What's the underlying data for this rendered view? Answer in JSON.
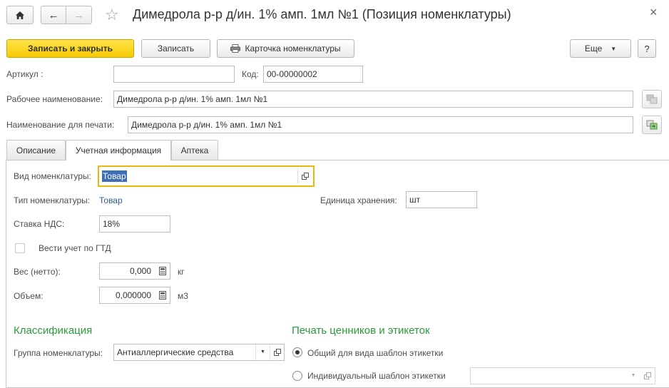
{
  "window": {
    "title": "Димедрола р-р д/ин. 1% амп. 1мл №1 (Позиция номенклатуры)",
    "close_symbol": "×"
  },
  "nav": {
    "home_icon": "home-icon",
    "back_symbol": "←",
    "forward_symbol": "→",
    "star_symbol": "☆"
  },
  "toolbar": {
    "save_close_label": "Записать и закрыть",
    "save_label": "Записать",
    "card_label": "Карточка номенклатуры",
    "more_label": "Еще",
    "more_arrow": "▼",
    "help_label": "?"
  },
  "header_fields": {
    "article_label": "Артикул :",
    "article_value": "",
    "code_label": "Код:",
    "code_value": "00-00000002",
    "work_name_label": "Рабочее наименование:",
    "work_name_value": "Димедрола р-р д/ин. 1% амп. 1мл №1",
    "print_name_label": "Наименование для печати:",
    "print_name_value": "Димедрола р-р д/ин. 1% амп. 1мл №1"
  },
  "tabs": [
    {
      "label": "Описание",
      "active": false
    },
    {
      "label": "Учетная информация",
      "active": true
    },
    {
      "label": "Аптека",
      "active": false
    }
  ],
  "accounting": {
    "kind_label": "Вид номенклатуры:",
    "kind_value": "Товар",
    "type_label": "Тип номенклатуры:",
    "type_value": "Товар",
    "unit_label": "Единица хранения:",
    "unit_value": "шт",
    "vat_label": "Ставка НДС:",
    "vat_value": "18%",
    "gtd_label": "Вести учет по ГТД",
    "gtd_checked": false,
    "weight_label": "Вес (нетто):",
    "weight_value": "0,000",
    "weight_unit": "кг",
    "volume_label": "Объем:",
    "volume_value": "0,000000",
    "volume_unit": "м3"
  },
  "classification": {
    "heading": "Классификация",
    "group_label": "Группа номенклатуры:",
    "group_value": "Антиаллергические средства"
  },
  "labels_print": {
    "heading": "Печать ценников и этикеток",
    "option_common": "Общий для вида шаблон этикетки",
    "option_individual": "Индивидуальный шаблон этикетки",
    "selected": "common"
  },
  "colors": {
    "accent_yellow": "#f6c900",
    "focus_border": "#e8b90a",
    "section_green": "#2d9a3c",
    "link_blue": "#2a5d8f",
    "selection_blue": "#3d6fb5"
  }
}
